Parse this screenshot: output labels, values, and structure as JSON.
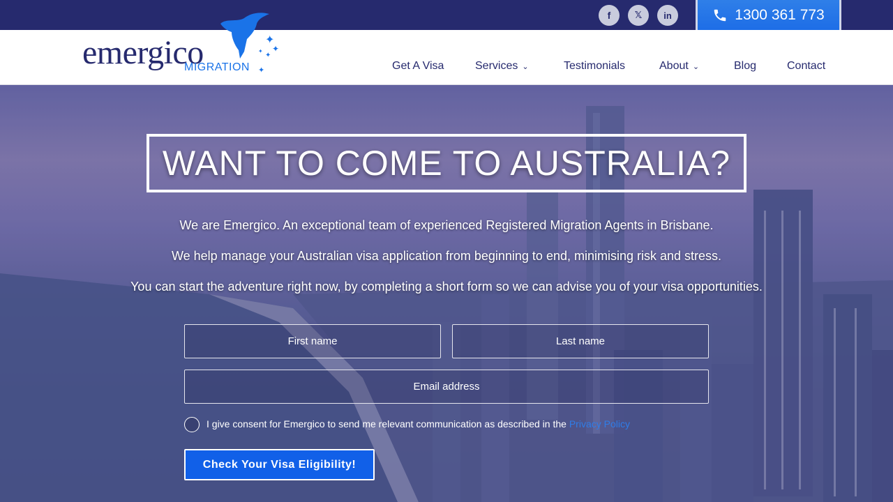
{
  "topbar": {
    "social": [
      {
        "name": "facebook",
        "glyph": "f"
      },
      {
        "name": "x-twitter",
        "glyph": "𝕏"
      },
      {
        "name": "linkedin",
        "glyph": "in"
      }
    ],
    "phone": "1300 361 773"
  },
  "header": {
    "logo_word": "emergico",
    "logo_sub": "MIGRATION",
    "nav": [
      {
        "label": "Get A Visa",
        "dropdown": false
      },
      {
        "label": "Services",
        "dropdown": true
      },
      {
        "label": "Testimonials",
        "dropdown": false
      },
      {
        "label": "About",
        "dropdown": true
      },
      {
        "label": "Blog",
        "dropdown": false
      },
      {
        "label": "Contact",
        "dropdown": false
      }
    ]
  },
  "hero": {
    "headline": "WANT TO COME TO AUSTRALIA?",
    "paragraphs": [
      "We are Emergico. An exceptional team of experienced Registered Migration Agents in Brisbane.",
      "We help manage your Australian visa application from beginning to end, minimising risk and stress.",
      "You can start the adventure right now, by completing a short form so we can advise you of your visa opportunities."
    ]
  },
  "form": {
    "first_name_placeholder": "First name",
    "last_name_placeholder": "Last name",
    "email_placeholder": "Email address",
    "consent_text": "I give consent for Emergico to send me relevant communication as described in the ",
    "consent_link": "Privacy Policy",
    "submit_label": "Check Your Visa Eligibility!"
  },
  "colors": {
    "brand_navy": "#262a6e",
    "brand_blue": "#1160e8"
  }
}
